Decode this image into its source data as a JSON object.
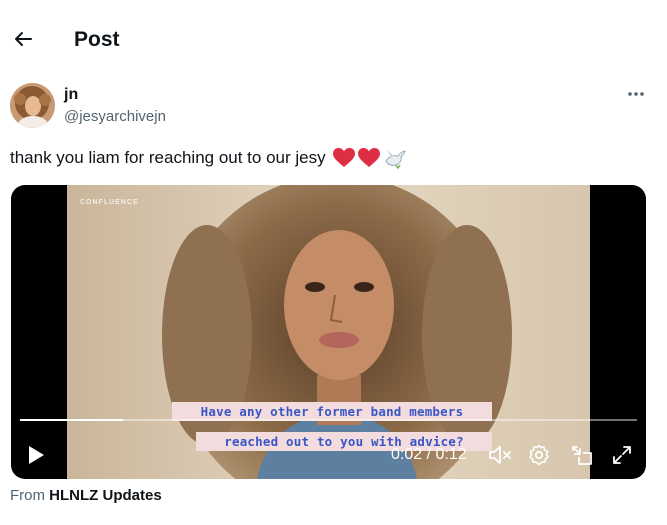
{
  "header": {
    "title": "Post",
    "back_icon": "arrow-left-icon"
  },
  "author": {
    "display_name": "jn",
    "handle": "@jesyarchivejn",
    "avatar": "avatar"
  },
  "more_icon": "more-horizontal-icon",
  "tweet": {
    "text": "thank you liam for reaching out to our jesy",
    "emojis": [
      "red-heart",
      "red-heart",
      "dove"
    ]
  },
  "video": {
    "watermark": "CONFLUENCE",
    "caption_line1": "Have any other former band members",
    "caption_line2": "reached out to you with advice?",
    "time_display": "0:02 / 0:12",
    "progress": 0.167,
    "controls": [
      "play-icon",
      "muted-volume-icon",
      "settings-icon",
      "pip-icon",
      "fullscreen-icon"
    ]
  },
  "source": {
    "prefix": "From",
    "name": "HLNLZ Updates"
  },
  "colors": {
    "text": "#0f1419",
    "secondary": "#536471",
    "caption_text": "#3a56c6",
    "caption_bg": "#f3dcde"
  }
}
